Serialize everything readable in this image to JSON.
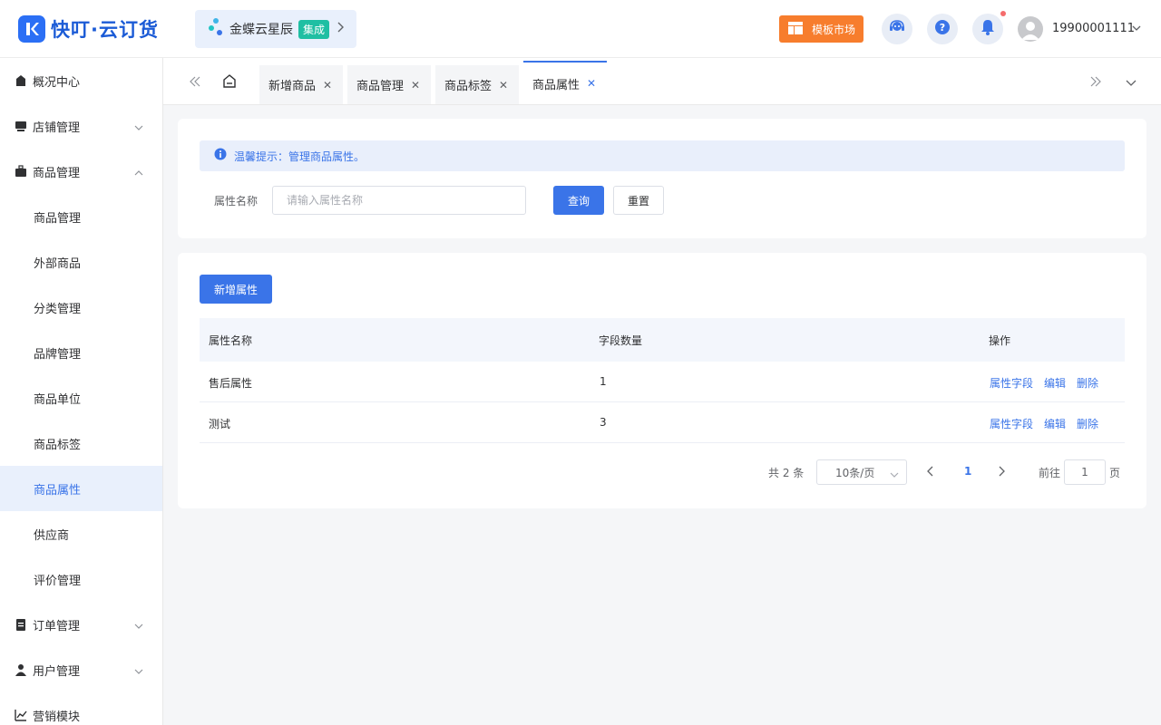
{
  "app": {
    "logo_text": "快叮·云订货",
    "kingdee_text": "金蝶云星辰",
    "kingdee_tag": "集成",
    "template_market": "模板市场",
    "username": "19900001111",
    "brand_color": "#3a74e8"
  },
  "sidebar": {
    "items": [
      {
        "label": "概况中心",
        "icon": "dashboard-icon"
      },
      {
        "label": "店铺管理",
        "icon": "store-icon"
      },
      {
        "label": "商品管理",
        "icon": "briefcase-icon"
      },
      {
        "label": "商品管理"
      },
      {
        "label": "外部商品"
      },
      {
        "label": "分类管理"
      },
      {
        "label": "品牌管理"
      },
      {
        "label": "商品单位"
      },
      {
        "label": "商品标签"
      },
      {
        "label": "商品属性"
      },
      {
        "label": "供应商"
      },
      {
        "label": "评价管理"
      },
      {
        "label": "订单管理",
        "icon": "clipboard-icon"
      },
      {
        "label": "用户管理",
        "icon": "user-icon"
      },
      {
        "label": "营销模块",
        "icon": "chart-icon"
      }
    ]
  },
  "tabs": [
    {
      "label": "新增商品"
    },
    {
      "label": "商品管理"
    },
    {
      "label": "商品标签"
    },
    {
      "label": "商品属性"
    }
  ],
  "notice": "温馨提示：管理商品属性。",
  "search": {
    "label": "属性名称",
    "placeholder": "请输入属性名称",
    "value": "",
    "query_btn": "查询",
    "reset_btn": "重置"
  },
  "table": {
    "add_btn": "新增属性",
    "headers": [
      "属性名称",
      "字段数量",
      "操作"
    ],
    "rows": [
      {
        "name": "售后属性",
        "count": "1"
      },
      {
        "name": "测试",
        "count": "3"
      }
    ],
    "actions": [
      "属性字段",
      "编辑",
      "删除"
    ]
  },
  "pagination": {
    "total": "共 2 条",
    "page_size": "10条/页",
    "current": "1",
    "goto_label": "前往",
    "goto_value": "1",
    "page_unit": "页"
  }
}
